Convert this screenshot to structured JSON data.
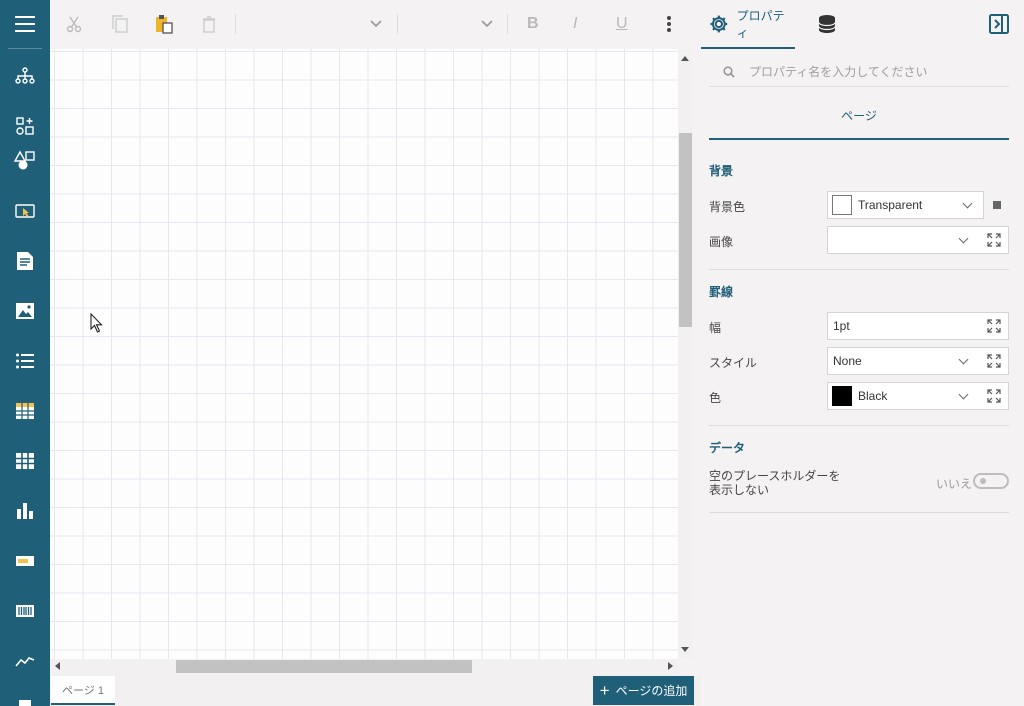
{
  "rail": {
    "items": [
      "hierarchy-icon",
      "components-icon",
      "shapes-icon",
      "select-icon",
      "textbox-icon",
      "image-icon",
      "list-icon",
      "table-icon",
      "matrix-icon",
      "chart-icon",
      "bullet-icon",
      "barcode-icon",
      "sparkline-icon"
    ]
  },
  "toolbar": {
    "bold": "B",
    "italic": "I",
    "underline": "U"
  },
  "tabs": {
    "properties": "プロパティ"
  },
  "canvas": {
    "add_page": "ページの追加",
    "page_tab": "ページ 1"
  },
  "properties": {
    "search_placeholder": "プロパティ名を入力してください",
    "title": "ページ",
    "background": {
      "section": "背景",
      "color_label": "背景色",
      "color_value": "Transparent",
      "image_label": "画像",
      "image_value": ""
    },
    "border": {
      "section": "罫線",
      "width_label": "幅",
      "width_value": "1pt",
      "style_label": "スタイル",
      "style_value": "None",
      "color_label": "色",
      "color_value": "Black"
    },
    "data": {
      "section": "データ",
      "placeholder_label_1": "空のプレースホルダーを",
      "placeholder_label_2": "表示しない",
      "toggle_text": "いいえ",
      "toggle_on": false
    }
  },
  "colors": {
    "accent": "#205f78",
    "panel_bg": "#f4f2f3"
  }
}
